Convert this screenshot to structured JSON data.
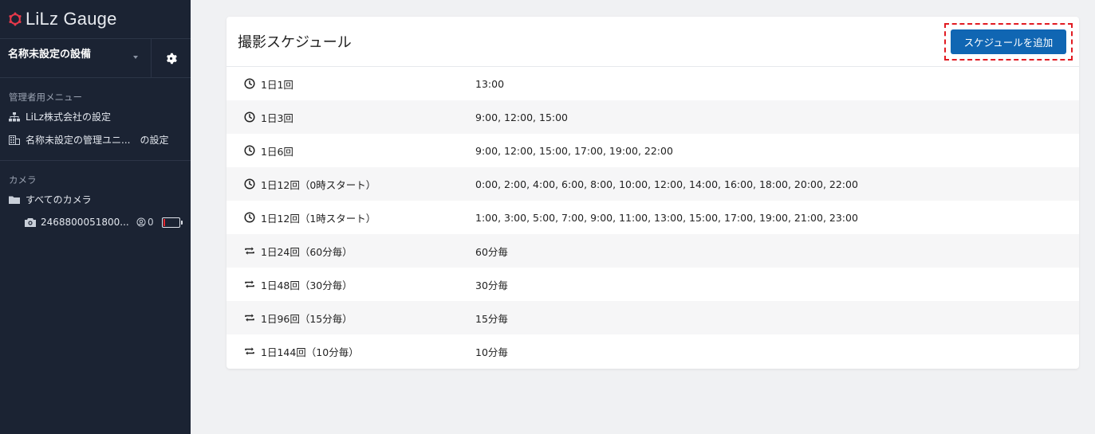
{
  "app": {
    "title": "LiLz Gauge",
    "accent": "#1066b3",
    "sidebar_bg": "#1b2333"
  },
  "sidebar": {
    "facility_name": "名称未設定の設備",
    "admin_section_title": "管理者用メニュー",
    "admin_items": [
      {
        "label": "LiLz株式会社の設定",
        "icon": "org-chart-icon"
      },
      {
        "label": "名称未設定の管理ユニ...　の設定",
        "icon": "building-icon"
      }
    ],
    "camera_section_title": "カメラ",
    "all_cameras_label": "すべてのカメラ",
    "camera": {
      "id": "2468800051800...",
      "count": "0",
      "battery_level": 0.1,
      "battery_color": "#e3262d"
    }
  },
  "main": {
    "title": "撮影スケジュール",
    "add_button_label": "スケジュールを追加",
    "schedules": [
      {
        "name": "1日1回",
        "times": "13:00",
        "icon": "clock-icon"
      },
      {
        "name": "1日3回",
        "times": "9:00, 12:00, 15:00",
        "icon": "clock-icon"
      },
      {
        "name": "1日6回",
        "times": "9:00, 12:00, 15:00, 17:00, 19:00, 22:00",
        "icon": "clock-icon"
      },
      {
        "name": "1日12回（0時スタート）",
        "times": "0:00, 2:00, 4:00, 6:00, 8:00, 10:00, 12:00, 14:00, 16:00, 18:00, 20:00, 22:00",
        "icon": "clock-icon"
      },
      {
        "name": "1日12回（1時スタート）",
        "times": "1:00, 3:00, 5:00, 7:00, 9:00, 11:00, 13:00, 15:00, 17:00, 19:00, 21:00, 23:00",
        "icon": "clock-icon"
      },
      {
        "name": "1日24回（60分毎）",
        "times": "60分毎",
        "icon": "repeat-icon"
      },
      {
        "name": "1日48回（30分毎）",
        "times": "30分毎",
        "icon": "repeat-icon"
      },
      {
        "name": "1日96回（15分毎）",
        "times": "15分毎",
        "icon": "repeat-icon"
      },
      {
        "name": "1日144回（10分毎）",
        "times": "10分毎",
        "icon": "repeat-icon"
      }
    ]
  }
}
